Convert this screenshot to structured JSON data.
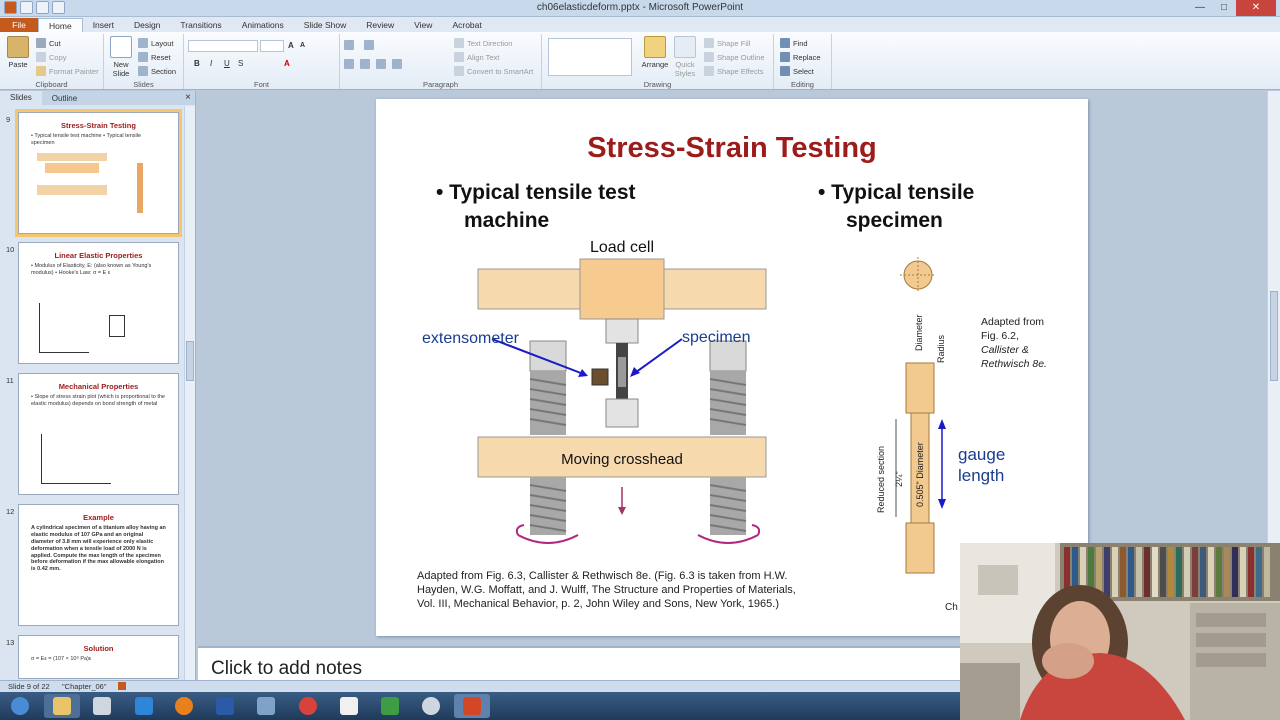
{
  "window": {
    "title": "ch06elasticdeform.pptx - Microsoft PowerPoint",
    "minimize": "—",
    "maximize": "□",
    "close": "✕"
  },
  "tabs": [
    "File",
    "Home",
    "Insert",
    "Design",
    "Transitions",
    "Animations",
    "Slide Show",
    "Review",
    "View",
    "Acrobat"
  ],
  "ribbon": {
    "clipboard": {
      "label": "Clipboard",
      "paste": "Paste",
      "cut": "Cut",
      "copy": "Copy",
      "format_painter": "Format Painter"
    },
    "slides": {
      "label": "Slides",
      "new_slide": "New Slide",
      "layout": "Layout",
      "reset": "Reset",
      "section": "Section"
    },
    "font": {
      "label": "Font"
    },
    "paragraph": {
      "label": "Paragraph",
      "text_direction": "Text Direction",
      "align_text": "Align Text",
      "smartart": "Convert to SmartArt"
    },
    "drawing": {
      "label": "Drawing",
      "arrange": "Arrange",
      "quick_styles": "Quick Styles",
      "shape_fill": "Shape Fill",
      "shape_outline": "Shape Outline",
      "shape_effects": "Shape Effects"
    },
    "editing": {
      "label": "Editing",
      "find": "Find",
      "replace": "Replace",
      "select": "Select"
    }
  },
  "left_panel": {
    "tabs": [
      "Slides",
      "Outline"
    ],
    "close": "×",
    "thumbnails": [
      {
        "num": "9",
        "title": "Stress-Strain Testing",
        "body": "• Typical tensile test machine   • Typical tensile specimen"
      },
      {
        "num": "10",
        "title": "Linear Elastic Properties",
        "body": "• Modulus of Elasticity, E: (also known as Young's modulus)  • Hooke's Law: σ = E ε"
      },
      {
        "num": "11",
        "title": "Mechanical Properties",
        "body": "• Slope of stress strain plot (which is proportional to the elastic modulus) depends on bond strength of metal"
      },
      {
        "num": "12",
        "title": "Example",
        "body": "A cylindrical specimen of a titanium alloy having an elastic modulus of 107 GPa and an original diameter of 3.8 mm will experience only elastic deformation when a tensile load of 2000 N is applied. Compute the max length of the specimen before deformation if the max allowable elongation is 0.42 mm."
      },
      {
        "num": "13",
        "title": "Solution",
        "body": "σ = Eε = (107 × 10⁹ Pa)ε"
      }
    ]
  },
  "slide": {
    "title": "Stress-Strain Testing",
    "bullet1_line1": "• Typical tensile  test",
    "bullet1_line2": "machine",
    "bullet2_line1": "• Typical tensile",
    "bullet2_line2": "specimen",
    "diagram_labels": {
      "load_cell": "Load cell",
      "extensometer": "extensometer",
      "specimen": "specimen",
      "moving_crosshead": "Moving crosshead",
      "diameter": "Diameter",
      "radius": "Radius",
      "reduced_section": "Reduced section",
      "length_24": "2¼\"",
      "diam_0505": "0.505\" Diameter",
      "gauge_line1": "gauge",
      "gauge_line2": "length"
    },
    "right_caption": [
      "Adapted from",
      "Fig. 6.2,",
      "Callister &",
      "Rethwisch 8e."
    ],
    "bottom_caption": [
      "Adapted from Fig. 6.3, Callister & Rethwisch 8e. (Fig. 6.3 is taken from H.W.",
      "Hayden, W.G. Moffatt, and J. Wulff, The Structure and Properties of Materials,",
      "Vol. III,  Mechanical Behavior, p. 2, John Wiley and Sons, New York, 1965.)"
    ],
    "corner_text": "Ch"
  },
  "notes": {
    "placeholder": "Click to add notes"
  },
  "status": {
    "slide": "Slide 9 of 22",
    "theme": "\"Chapter_06\""
  }
}
